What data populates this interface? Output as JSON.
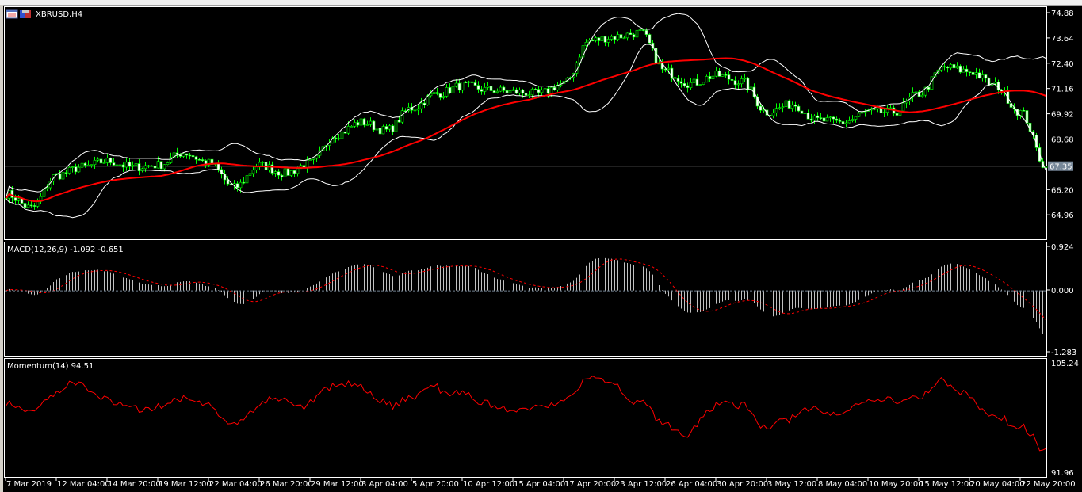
{
  "window": {
    "title": "XBRUSD,H4",
    "icons": [
      "chart-window-icon",
      "save-icon"
    ]
  },
  "colors": {
    "background": "#000000",
    "bull": "#00ff00",
    "bear": "#ffffff",
    "ma": "#ff0000",
    "bands": "#ffffff",
    "macd_hist": "#c0c0c0",
    "macd_signal": "#ff0000",
    "momentum": "#ff0000",
    "price_label_bg": "#778899"
  },
  "chart_data": [
    {
      "type": "candlestick",
      "title": "XBRUSD,H4",
      "symbol": "XBRUSD",
      "timeframe": "H4",
      "indicators": [
        "Moving Average (red)",
        "Bollinger Bands (white)"
      ],
      "ylim": [
        64.5,
        75.1
      ],
      "y_ticks": [
        "74.88",
        "73.64",
        "72.40",
        "71.16",
        "69.92",
        "68.68",
        "66.20",
        "64.96"
      ],
      "current_price": "67.35",
      "x_ticks": [
        "7 Mar 2019",
        "12 Mar 04:00",
        "14 Mar 20:00",
        "19 Mar 12:00",
        "22 Mar 04:00",
        "26 Mar 20:00",
        "29 Mar 12:00",
        "3 Apr 04:00",
        "5 Apr 20:00",
        "10 Apr 12:00",
        "15 Apr 04:00",
        "17 Apr 20:00",
        "23 Apr 12:00",
        "26 Apr 04:00",
        "30 Apr 20:00",
        "3 May 12:00",
        "8 May 04:00",
        "10 May 20:00",
        "15 May 12:00",
        "20 May 04:00",
        "22 May 20:00"
      ],
      "close_approx": [
        66.0,
        65.3,
        66.9,
        67.3,
        67.6,
        67.3,
        67.4,
        68.0,
        67.5,
        66.3,
        67.4,
        67.0,
        67.5,
        68.9,
        69.5,
        69.1,
        70.2,
        70.9,
        71.3,
        71.1,
        71.0,
        70.9,
        71.4,
        73.5,
        73.7,
        73.9,
        72.0,
        71.4,
        71.8,
        71.5,
        70.0,
        70.4,
        69.6,
        69.5,
        70.0,
        70.0,
        70.9,
        72.2,
        72.0,
        71.3,
        70.0,
        67.35
      ]
    },
    {
      "type": "bar",
      "title": "MACD(12,26,9) -1.092 -0.651",
      "label": "MACD(12,26,9)",
      "values_last": [
        "-1.092",
        "-0.651"
      ],
      "y_ticks": [
        "0.924",
        "0.000",
        "-1.283"
      ],
      "ylim": [
        -1.283,
        0.924
      ]
    },
    {
      "type": "line",
      "title": "Momentum(14) 94.51",
      "label": "Momentum(14)",
      "value_last": "94.51",
      "y_ticks": [
        "105.24",
        "91.96"
      ],
      "ylim": [
        91.96,
        105.24
      ]
    }
  ]
}
